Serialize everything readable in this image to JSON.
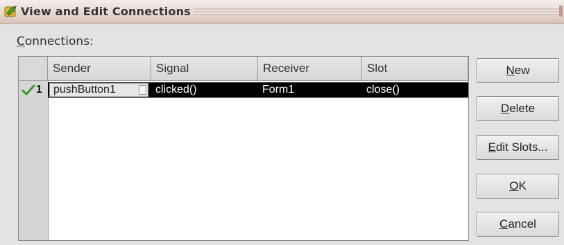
{
  "window": {
    "title": "View and Edit Connections",
    "icon": "designer-app-icon"
  },
  "connections_label": {
    "accel": "C",
    "rest": "onnections:"
  },
  "table": {
    "columns": [
      "Sender",
      "Signal",
      "Receiver",
      "Slot"
    ],
    "rows": [
      {
        "number": "1",
        "status_icon": "check-icon",
        "sender": "pushButton1",
        "signal": "clicked()",
        "receiver": "Form1",
        "slot": "close()",
        "selected": true
      }
    ]
  },
  "buttons": {
    "new": {
      "accel": "N",
      "rest": "ew"
    },
    "delete": {
      "accel": "D",
      "rest": "elete"
    },
    "edit_slots": {
      "accel": "E",
      "rest": "dit Slots..."
    },
    "ok": {
      "accel": "O",
      "rest": "K"
    },
    "cancel": {
      "accel": "C",
      "rest": "ancel"
    }
  },
  "colors": {
    "selection_bg": "#000000",
    "selection_fg": "#ffffff",
    "check": "#3a9a2a"
  }
}
